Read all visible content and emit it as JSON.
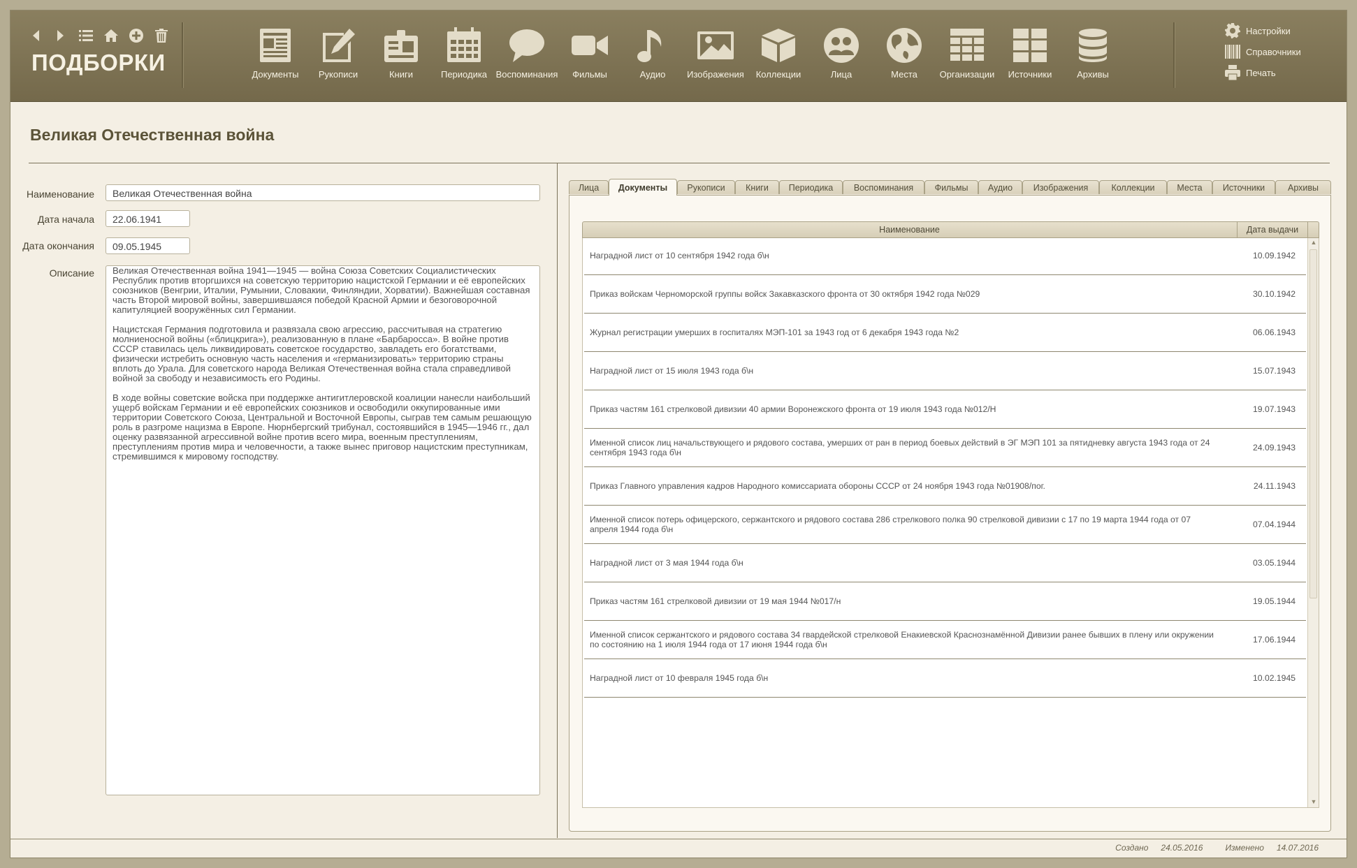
{
  "app": {
    "title": "ПОДБОРКИ",
    "nav": [
      "back-icon",
      "forward-icon",
      "list-icon",
      "home-icon",
      "add-icon",
      "trash-icon"
    ]
  },
  "modules": [
    {
      "label": "Документы",
      "icon": "documents-icon"
    },
    {
      "label": "Рукописи",
      "icon": "manuscript-pencil-icon"
    },
    {
      "label": "Книги",
      "icon": "book-icon"
    },
    {
      "label": "Периодика",
      "icon": "calendar-icon"
    },
    {
      "label": "Воспоминания",
      "icon": "speech-bubble-icon"
    },
    {
      "label": "Фильмы",
      "icon": "video-camera-icon"
    },
    {
      "label": "Аудио",
      "icon": "music-note-icon"
    },
    {
      "label": "Изображения",
      "icon": "image-icon"
    },
    {
      "label": "Коллекции",
      "icon": "box-icon"
    },
    {
      "label": "Лица",
      "icon": "people-icon"
    },
    {
      "label": "Места",
      "icon": "globe-icon"
    },
    {
      "label": "Организации",
      "icon": "grid-table-icon"
    },
    {
      "label": "Источники",
      "icon": "tiles-icon"
    },
    {
      "label": "Архивы",
      "icon": "database-icon"
    }
  ],
  "right_menu": {
    "settings": "Настройки",
    "references": "Справочники",
    "print": "Печать"
  },
  "page": {
    "title": "Великая Отечественная война"
  },
  "form": {
    "name_label": "Наименование",
    "name_value": "Великая Отечественная война",
    "start_label": "Дата начала",
    "start_value": "22.06.1941",
    "end_label": "Дата окончания",
    "end_value": "09.05.1945",
    "desc_label": "Описание",
    "desc_paragraphs": [
      "Великая Отечественная война 1941—1945 — война Союза Советских Социалистических Республик против вторгшихся на советскую территорию нацистской Германии и её европейских союзников (Венгрии, Италии, Румынии, Словакии, Финляндии, Хорватии). Важнейшая составная часть Второй мировой войны, завершившаяся победой Красной Армии и безоговорочной капитуляцией вооружённых сил Германии.",
      "Нацистская Германия подготовила и развязала свою агрессию, рассчитывая на стратегию молниеносной войны («блицкрига»), реализованную в плане «Барбаросса». В войне против СССР ставилась цель ликвидировать советское государство, завладеть его богатствами, физически истребить основную часть населения и «германизировать» территорию страны вплоть до Урала. Для советского народа Великая Отечественная война стала справедливой войной за свободу и независимость его Родины.",
      "В ходе войны советские войска при поддержке антигитлеровской коалиции нанесли наибольший ущерб войскам Германии и её европейских союзников и освободили оккупированные ими территории Советского Союза, Центральной и Восточной Европы, сыграв тем самым решающую роль в разгроме нацизма в Европе. Нюрнбергский трибунал, состоявшийся в 1945—1946 гг., дал оценку развязанной агрессивной войне против всего мира, военным преступлениям, преступлениям против мира и человечности, а также вынес приговор нацистским преступникам, стремившимся к мировому господству."
    ]
  },
  "tabs": [
    {
      "label": "Лица",
      "active": false
    },
    {
      "label": "Документы",
      "active": true
    },
    {
      "label": "Рукописи",
      "active": false
    },
    {
      "label": "Книги",
      "active": false
    },
    {
      "label": "Периодика",
      "active": false
    },
    {
      "label": "Воспоминания",
      "active": false
    },
    {
      "label": "Фильмы",
      "active": false
    },
    {
      "label": "Аудио",
      "active": false
    },
    {
      "label": "Изображения",
      "active": false
    },
    {
      "label": "Коллекции",
      "active": false
    },
    {
      "label": "Места",
      "active": false
    },
    {
      "label": "Источники",
      "active": false
    },
    {
      "label": "Архивы",
      "active": false
    }
  ],
  "table": {
    "columns": [
      "Наименование",
      "Дата выдачи"
    ],
    "rows": [
      {
        "name": "Наградной лист от 10 сентября 1942 года б\\н",
        "date": "10.09.1942"
      },
      {
        "name": "Приказ войскам Черноморской группы войск Закавказского фронта от 30 октября 1942 года №029",
        "date": "30.10.1942"
      },
      {
        "name": "Журнал регистрации умерших в госпиталях МЭП-101 за 1943 год от 6 декабря 1943 года №2",
        "date": "06.06.1943"
      },
      {
        "name": "Наградной лист от 15 июля 1943 года б\\н",
        "date": "15.07.1943"
      },
      {
        "name": "Приказ частям 161 стрелковой дивизии 40 армии Воронежского фронта от 19 июля 1943 года №012/Н",
        "date": "19.07.1943"
      },
      {
        "name": "Именной список лиц начальствующего и рядового состава, умерших от ран в период боевых действий в ЭГ МЭП 101 за пятидневку августа 1943 года от 24 сентября 1943 года б\\н",
        "date": "24.09.1943"
      },
      {
        "name": "Приказ Главного управления кадров Народного комиссариата обороны СССР от 24 ноября 1943 года №01908/пог.",
        "date": "24.11.1943"
      },
      {
        "name": "Именной список потерь офицерского, сержантского и рядового состава 286 стрелкового полка 90 стрелковой дивизии с 17 по 19 марта 1944 года от 07 апреля 1944 года б\\н",
        "date": "07.04.1944"
      },
      {
        "name": "Наградной лист от 3 мая 1944 года б\\н",
        "date": "03.05.1944"
      },
      {
        "name": "Приказ частям 161 стрелковой дивизии от 19 мая 1944 №017/н",
        "date": "19.05.1944"
      },
      {
        "name": "Именной список сержантского и рядового состава 34 гвардейской стрелковой Енакиевской Краснознамённой Дивизии ранее бывших в плену или окружении по состоянию на 1 июля 1944 года от 17 июня 1944 года б\\н",
        "date": "17.06.1944"
      },
      {
        "name": "Наградной лист от 10 февраля 1945 года б\\н",
        "date": "10.02.1945"
      }
    ]
  },
  "footer": {
    "created_label": "Создано",
    "created_value": "24.05.2016",
    "modified_label": "Изменено",
    "modified_value": "14.07.2016"
  },
  "colors": {
    "header": "#7e7354",
    "background": "#f4efe4",
    "frame": "#b5ad93",
    "accent_text": "#5b5338"
  }
}
